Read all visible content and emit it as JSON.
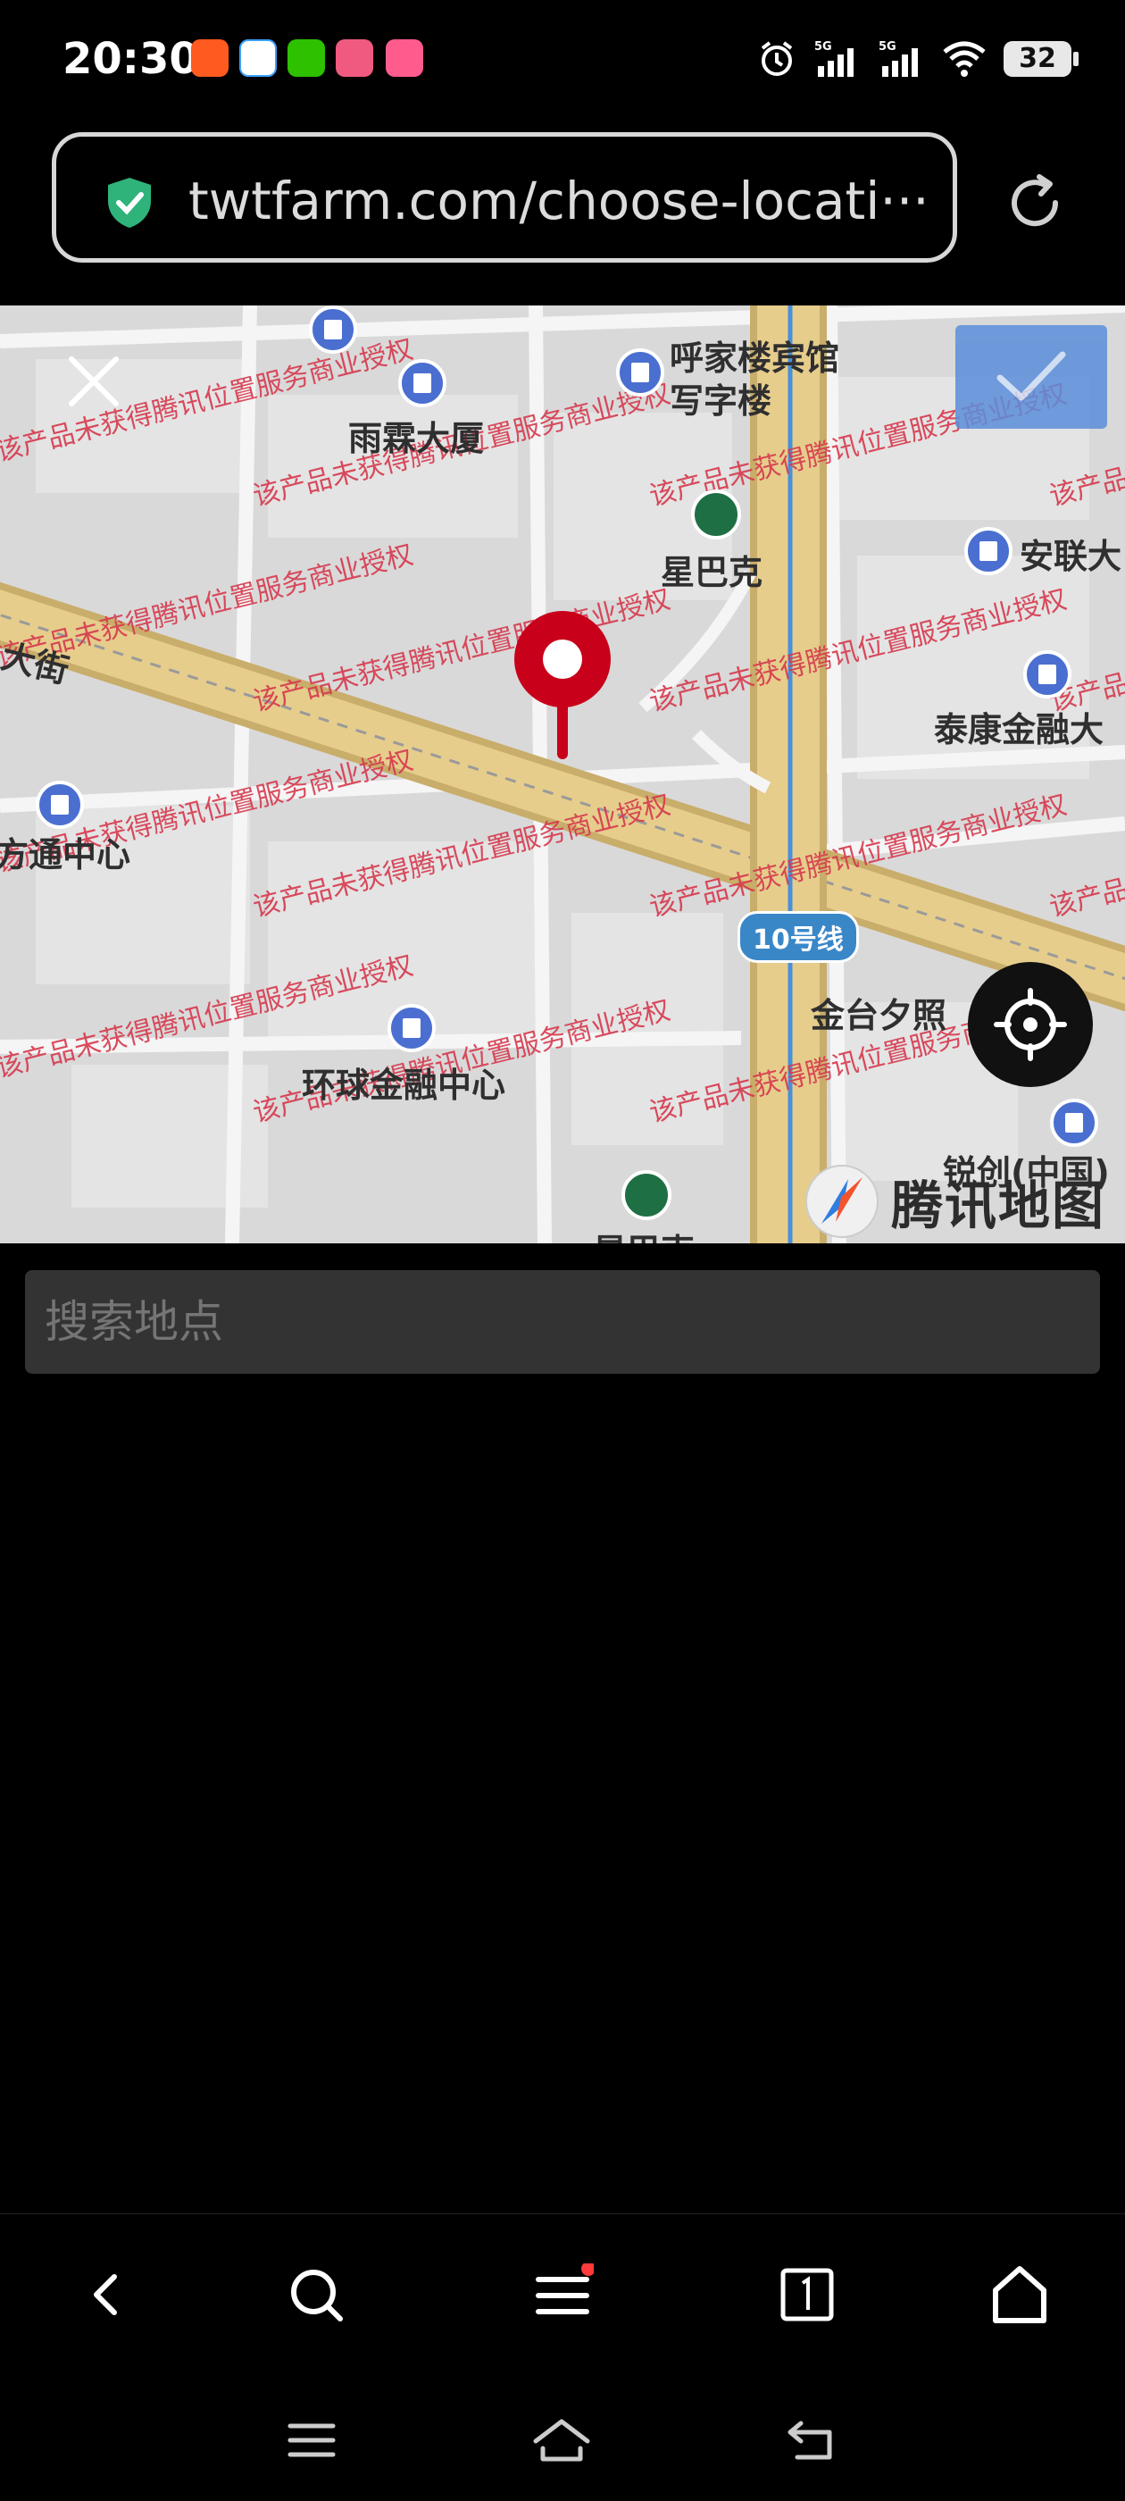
{
  "status_bar": {
    "time": "20:30",
    "battery": "32",
    "network_1": "5G",
    "network_2": "5G"
  },
  "browser": {
    "url": "twtfarm.com/choose-locati···"
  },
  "map": {
    "labels": {
      "huojia": "呼家楼宾馆",
      "huojia2": "写字楼",
      "yulin": "雨霖大厦",
      "starbucks": "星巴克",
      "anlian": "安联大",
      "taikang": "泰康金融大",
      "dajie": "大街",
      "fangtong": "方通中心",
      "huanqiu": "环球金融中心",
      "jintai": "金台夕照",
      "ruijian": "锐创(中国)",
      "line10": "10号线",
      "xingbake2": "星巴克"
    },
    "watermark": "该产品未获得腾讯位置服务商业授权",
    "brand": "腾讯地图"
  },
  "search": {
    "placeholder": "搜索地点"
  },
  "colors": {
    "pin": "#d0021b",
    "confirm": "#5b8edb",
    "watermark": "#d6394d"
  }
}
